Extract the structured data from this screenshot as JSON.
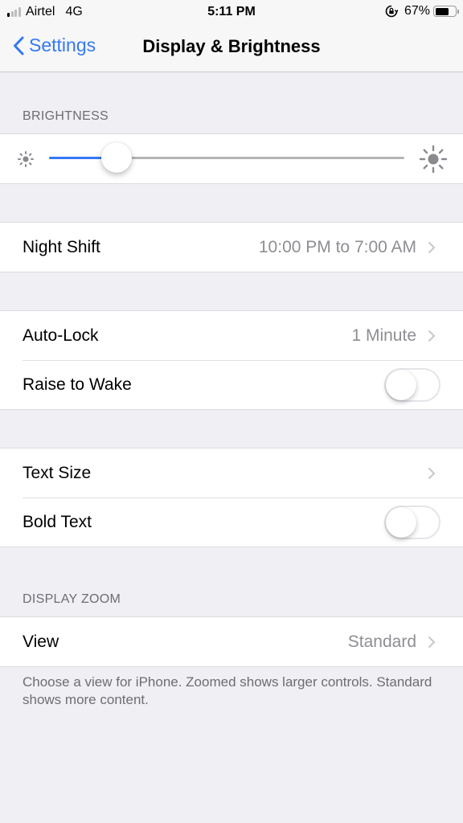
{
  "status_bar": {
    "carrier": "Airtel",
    "network": "4G",
    "signal_bars_active": 1,
    "signal_bars_total": 4,
    "time": "5:11 PM",
    "rotation_lock_icon": "rotation-lock-icon",
    "battery_percent_label": "67%",
    "battery_level": 0.67
  },
  "nav": {
    "back_label": "Settings",
    "back_icon": "chevron-left-icon",
    "title": "Display & Brightness",
    "accent_color": "#3478f6"
  },
  "brightness": {
    "header": "BRIGHTNESS",
    "level": 0.19,
    "min_icon": "sun-small-icon",
    "max_icon": "sun-large-icon"
  },
  "night_shift": {
    "label": "Night Shift",
    "value": "10:00 PM to 7:00 AM"
  },
  "lock_group": {
    "auto_lock": {
      "label": "Auto-Lock",
      "value": "1 Minute"
    },
    "raise_to_wake": {
      "label": "Raise to Wake",
      "on": false
    }
  },
  "text_group": {
    "text_size": {
      "label": "Text Size"
    },
    "bold_text": {
      "label": "Bold Text",
      "on": false
    }
  },
  "display_zoom": {
    "header": "DISPLAY ZOOM",
    "view": {
      "label": "View",
      "value": "Standard"
    },
    "footer": "Choose a view for iPhone. Zoomed shows larger controls. Standard shows more content."
  }
}
